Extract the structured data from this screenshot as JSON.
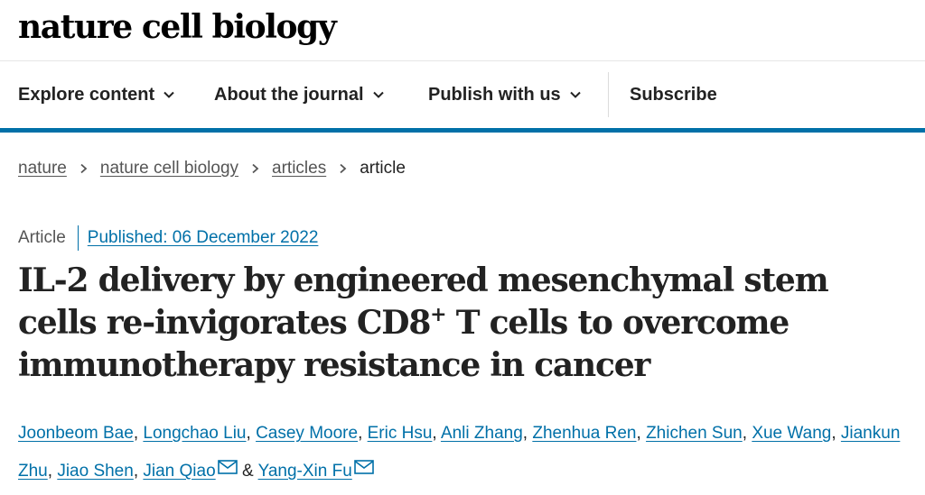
{
  "site": {
    "logo": "nature cell biology"
  },
  "nav": {
    "explore": "Explore content",
    "about": "About the journal",
    "publish": "Publish with us",
    "subscribe": "Subscribe"
  },
  "breadcrumb": {
    "items": [
      "nature",
      "nature cell biology",
      "articles",
      "article"
    ]
  },
  "article": {
    "type": "Article",
    "published": "Published: 06 December 2022",
    "title_part1": "IL-2 delivery by engineered mesenchymal stem cells re-invigorates CD8",
    "title_sup": "+",
    "title_part2": " T cells to overcome immunotherapy resistance in cancer",
    "authors": [
      "Joonbeom Bae",
      "Longchao Liu",
      "Casey Moore",
      "Eric Hsu",
      "Anli Zhang",
      "Zhenhua Ren",
      "Zhichen Sun",
      "Xue Wang",
      "Jiankun Zhu",
      "Jiao Shen",
      "Jian Qiao",
      "Yang-Xin Fu"
    ],
    "author_separator": ", ",
    "author_and": " & "
  },
  "icons": {
    "chevron": "chevron-down-icon",
    "breadcrumb_sep": "chevron-right-icon",
    "mail": "mail-icon"
  },
  "colors": {
    "link": "#0070a8",
    "nav_underline": "#0070a8",
    "text": "#222222"
  }
}
